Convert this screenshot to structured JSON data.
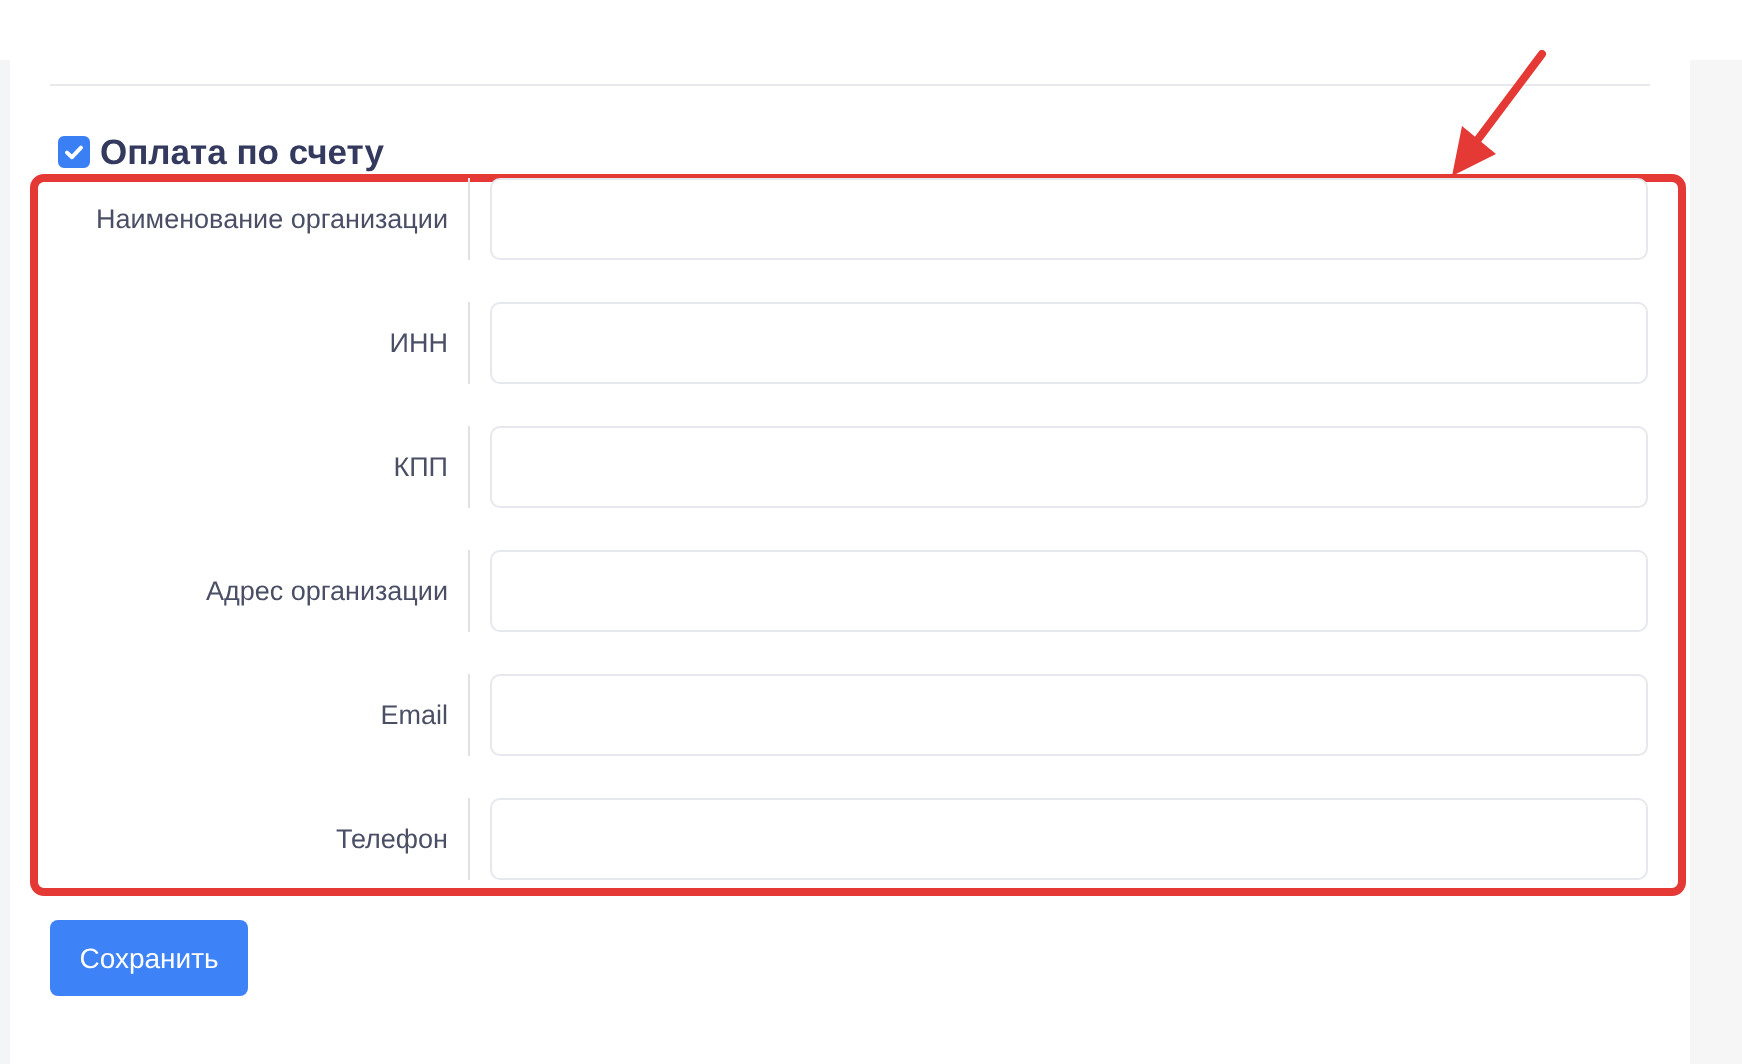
{
  "payment_by_invoice": {
    "label": "Оплата по счету",
    "checked": true
  },
  "fields": [
    {
      "label": "Наименование организации"
    },
    {
      "label": "ИНН"
    },
    {
      "label": "КПП"
    },
    {
      "label": "Адрес организации"
    },
    {
      "label": "Email"
    },
    {
      "label": "Телефон"
    }
  ],
  "save_button": "Сохранить"
}
